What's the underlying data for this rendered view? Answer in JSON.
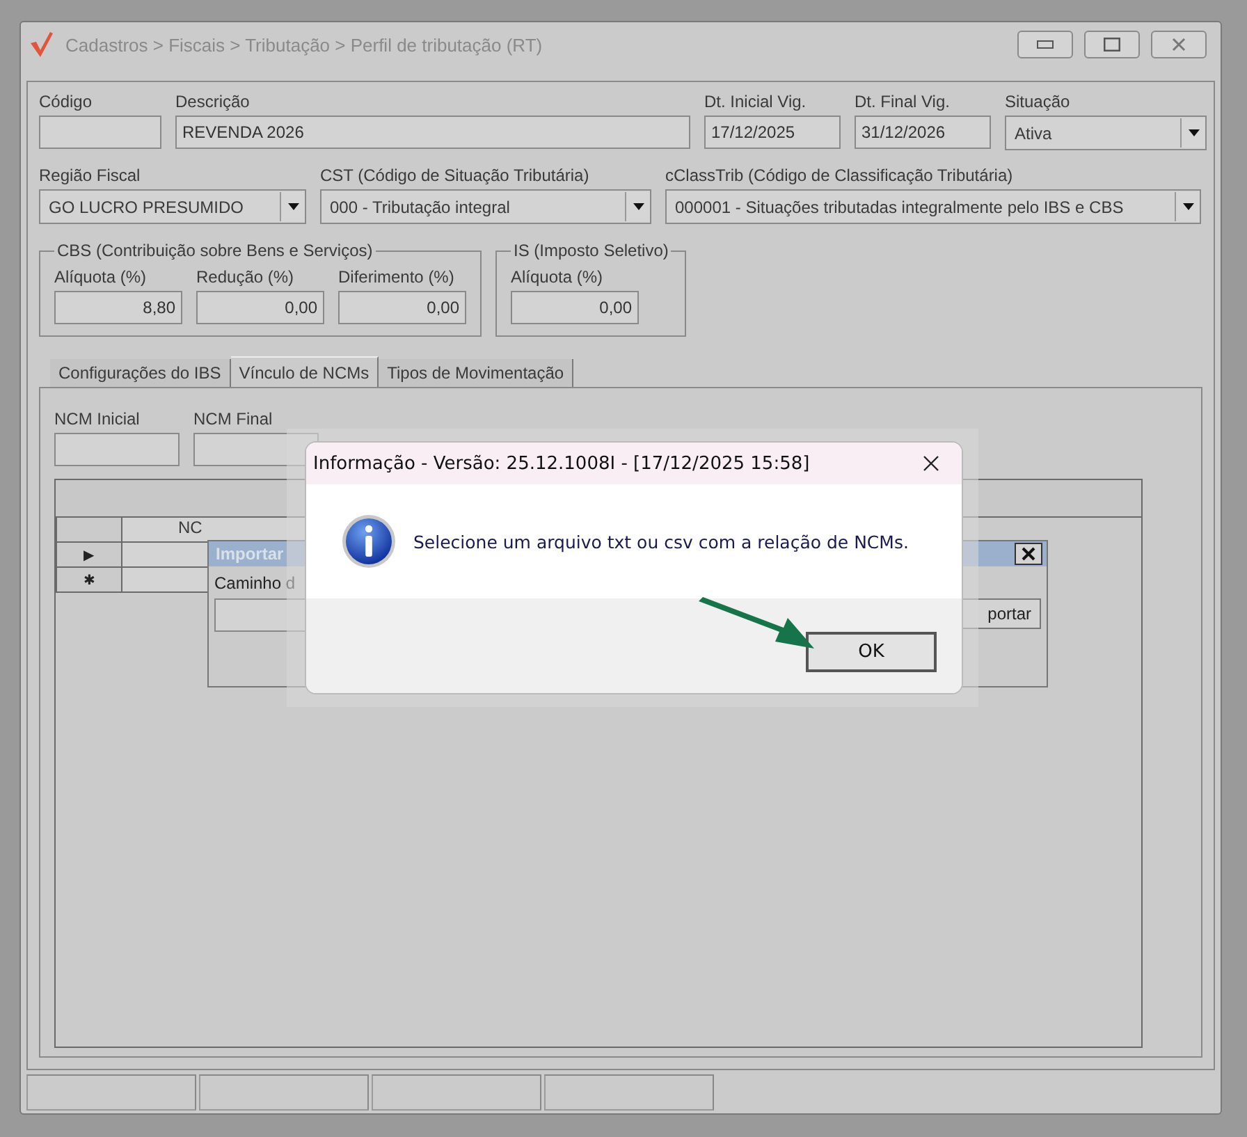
{
  "window": {
    "title": "Cadastros > Fiscais > Tributação > Perfil de tributação (RT)"
  },
  "row_1": [
    {
      "kind": "text",
      "label": "Código"
    },
    {
      "kind": "text",
      "label": "Descrição",
      "value": "REVENDA 2026"
    },
    {
      "kind": "text",
      "label": "Dt. Inicial Vig.",
      "value": "17/12/2025"
    },
    {
      "kind": "text",
      "label": "Dt. Final Vig.",
      "value": "31/12/2026"
    },
    {
      "kind": "select",
      "label": "Situação",
      "value": "Ativa"
    }
  ],
  "row_2": [
    {
      "kind": "select",
      "label": "Região Fiscal",
      "value": "GO LUCRO PRESUMIDO"
    },
    {
      "kind": "select",
      "label": "CST (Código de Situação Tributária)",
      "value": "000 - Tributação integral"
    },
    {
      "kind": "select",
      "label": "cClassTrib (Código de Classificação Tributária)",
      "value": "000001 - Situações tributadas integralmente pelo IBS e CBS"
    }
  ],
  "groups": [
    {
      "title": "CBS (Contribuição sobre Bens e Serviços)",
      "fields": [
        {
          "label": "Alíquota (%)",
          "value": "8,80"
        },
        {
          "label": "Redução (%)",
          "value": "0,00"
        },
        {
          "label": "Diferimento (%)",
          "value": "0,00"
        }
      ]
    },
    {
      "title": "IS (Imposto Seletivo)",
      "fields": [
        {
          "label": "Alíquota (%)",
          "value": "0,00"
        }
      ]
    }
  ],
  "tabs": [
    {
      "label": "Configurações do IBS",
      "selected": false
    },
    {
      "label": "Vínculo de NCMs",
      "selected": true
    },
    {
      "label": "Tipos de Movimentação",
      "selected": false
    }
  ],
  "ncm_filter": [
    {
      "label": "NCM Inicial"
    },
    {
      "label": "NCM Final"
    }
  ],
  "grid": {
    "column_1": "NC",
    "rows": [
      {
        "indicator": "▶"
      },
      {
        "indicator": "✱"
      }
    ]
  },
  "import_window": {
    "title": "Importar",
    "label": "Caminho d",
    "button": "portar"
  },
  "dialog": {
    "title": "Informação - Versão: 25.12.1008I - [17/12/2025 15:58]",
    "message": "Selecione um arquivo txt ou csv com a relação de NCMs.",
    "button": "OK"
  }
}
